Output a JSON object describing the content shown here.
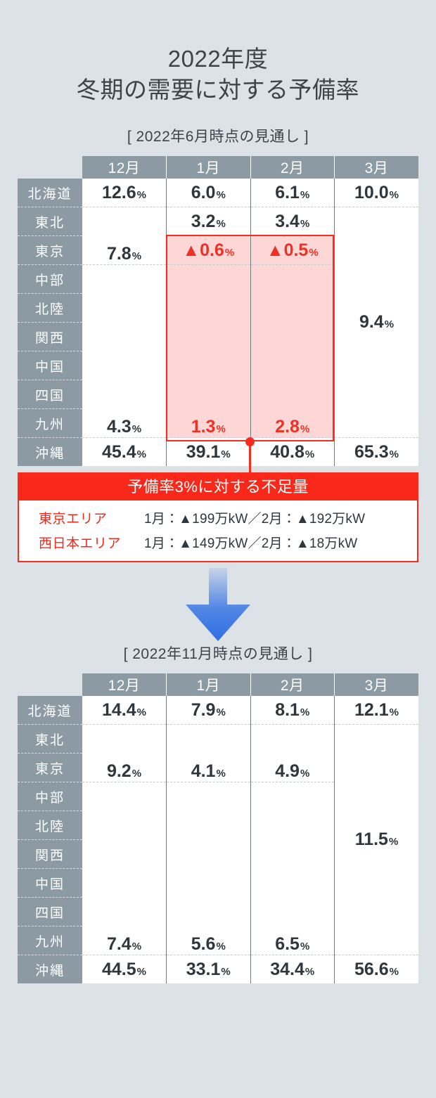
{
  "title": {
    "line1": "2022年度",
    "line2": "冬期の需要に対する予備率"
  },
  "colors": {
    "background": "#dde2e7",
    "header_gray": "#8c9aa4",
    "alert_red": "#fa2a1c",
    "alert_fill": "#fcd7d5",
    "arrow_blue": "#2f6fe4",
    "text_dark": "#2f363c"
  },
  "table1": {
    "caption": "[ 2022年6月時点の見通し ]",
    "columns": [
      "12月",
      "1月",
      "2月",
      "3月"
    ],
    "rows": [
      "北海道",
      "東北",
      "東京",
      "中部",
      "北陸",
      "関西",
      "中国",
      "四国",
      "九州",
      "沖縄"
    ],
    "cells": {
      "hokkaido": {
        "dec": "12.6",
        "jan": "6.0",
        "feb": "6.1",
        "mar": "10.0"
      },
      "tohoku_tokyo_dec": "7.8",
      "tohoku_jan": "3.2",
      "tohoku_feb": "3.4",
      "tokyo_jan": "▲0.6",
      "tokyo_feb": "▲0.5",
      "west_dec": "4.3",
      "west_jan": "1.3",
      "west_feb": "2.8",
      "mar_merged": "9.4",
      "okinawa": {
        "dec": "45.4",
        "jan": "39.1",
        "feb": "40.8",
        "mar": "65.3"
      }
    },
    "percent_symbol": "%"
  },
  "callout": {
    "heading": "予備率3%に対する不足量",
    "rows": [
      {
        "area": "東京エリア",
        "value": "1月：▲199万kW／2月：▲192万kW"
      },
      {
        "area": "西日本エリア",
        "value": "1月：▲149万kW／2月：▲18万kW"
      }
    ]
  },
  "arrow": {
    "name": "down-arrow"
  },
  "table2": {
    "caption": "[ 2022年11月時点の見通し ]",
    "columns": [
      "12月",
      "1月",
      "2月",
      "3月"
    ],
    "rows": [
      "北海道",
      "東北",
      "東京",
      "中部",
      "北陸",
      "関西",
      "中国",
      "四国",
      "九州",
      "沖縄"
    ],
    "cells": {
      "hokkaido": {
        "dec": "14.4",
        "jan": "7.9",
        "feb": "8.1",
        "mar": "12.1"
      },
      "tohoku_tokyo_dec": "9.2",
      "tohoku_tokyo_jan": "4.1",
      "tohoku_tokyo_feb": "4.9",
      "west_dec": "7.4",
      "west_jan": "5.6",
      "west_feb": "6.5",
      "mar_merged": "11.5",
      "okinawa": {
        "dec": "44.5",
        "jan": "33.1",
        "feb": "34.4",
        "mar": "56.6"
      }
    },
    "percent_symbol": "%"
  },
  "chart_data": {
    "type": "table",
    "title": "2022年度 冬期の需要に対する予備率",
    "tables": [
      {
        "name": "2022年6月時点の見通し",
        "columns": [
          "エリア",
          "12月",
          "1月",
          "2月",
          "3月"
        ],
        "unit": "%",
        "rows": [
          {
            "area": "北海道",
            "dec": 12.6,
            "jan": 6.0,
            "feb": 6.1,
            "mar": 10.0
          },
          {
            "area": "東北",
            "dec": 7.8,
            "jan": 3.2,
            "feb": 3.4,
            "mar": 9.4
          },
          {
            "area": "東京",
            "dec": 7.8,
            "jan": -0.6,
            "feb": -0.5,
            "mar": 9.4
          },
          {
            "area": "中部",
            "dec": 4.3,
            "jan": 1.3,
            "feb": 2.8,
            "mar": 9.4
          },
          {
            "area": "北陸",
            "dec": 4.3,
            "jan": 1.3,
            "feb": 2.8,
            "mar": 9.4
          },
          {
            "area": "関西",
            "dec": 4.3,
            "jan": 1.3,
            "feb": 2.8,
            "mar": 9.4
          },
          {
            "area": "中国",
            "dec": 4.3,
            "jan": 1.3,
            "feb": 2.8,
            "mar": 9.4
          },
          {
            "area": "四国",
            "dec": 4.3,
            "jan": 1.3,
            "feb": 2.8,
            "mar": 9.4
          },
          {
            "area": "九州",
            "dec": 4.3,
            "jan": 1.3,
            "feb": 2.8,
            "mar": 9.4
          },
          {
            "area": "沖縄",
            "dec": 45.4,
            "jan": 39.1,
            "feb": 40.8,
            "mar": 65.3
          }
        ],
        "highlight": "1月・2月の東京〜九州エリアが予備率3%を下回る"
      },
      {
        "name": "2022年11月時点の見通し",
        "columns": [
          "エリア",
          "12月",
          "1月",
          "2月",
          "3月"
        ],
        "unit": "%",
        "rows": [
          {
            "area": "北海道",
            "dec": 14.4,
            "jan": 7.9,
            "feb": 8.1,
            "mar": 12.1
          },
          {
            "area": "東北",
            "dec": 9.2,
            "jan": 4.1,
            "feb": 4.9,
            "mar": 11.5
          },
          {
            "area": "東京",
            "dec": 9.2,
            "jan": 4.1,
            "feb": 4.9,
            "mar": 11.5
          },
          {
            "area": "中部",
            "dec": 7.4,
            "jan": 5.6,
            "feb": 6.5,
            "mar": 11.5
          },
          {
            "area": "北陸",
            "dec": 7.4,
            "jan": 5.6,
            "feb": 6.5,
            "mar": 11.5
          },
          {
            "area": "関西",
            "dec": 7.4,
            "jan": 5.6,
            "feb": 6.5,
            "mar": 11.5
          },
          {
            "area": "中国",
            "dec": 7.4,
            "jan": 5.6,
            "feb": 6.5,
            "mar": 11.5
          },
          {
            "area": "四国",
            "dec": 7.4,
            "jan": 5.6,
            "feb": 6.5,
            "mar": 11.5
          },
          {
            "area": "九州",
            "dec": 7.4,
            "jan": 5.6,
            "feb": 6.5,
            "mar": 11.5
          },
          {
            "area": "沖縄",
            "dec": 44.5,
            "jan": 33.1,
            "feb": 34.4,
            "mar": 56.6
          }
        ]
      }
    ],
    "annotation": {
      "heading": "予備率3%に対する不足量",
      "items": [
        {
          "area": "東京エリア",
          "jan_mankW": -199,
          "feb_mankW": -192
        },
        {
          "area": "西日本エリア",
          "jan_mankW": -149,
          "feb_mankW": -18
        }
      ]
    }
  }
}
